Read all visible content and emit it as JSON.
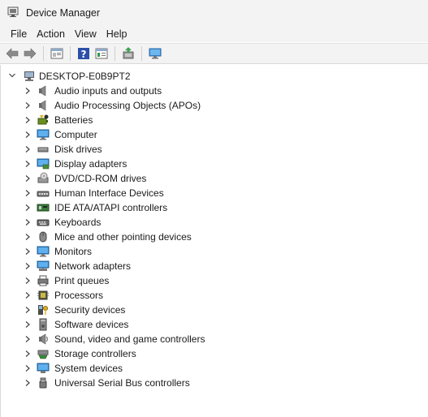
{
  "window": {
    "title": "Device Manager"
  },
  "menu": [
    "File",
    "Action",
    "View",
    "Help"
  ],
  "toolbar": [
    "back-icon",
    "forward-icon",
    "properties-icon",
    "help-icon",
    "show-hide-tree-icon",
    "update-driver-icon",
    "computer-monitor-icon"
  ],
  "tree": {
    "root": "DESKTOP-E0B9PT2",
    "categories": [
      {
        "label": "Audio inputs and outputs",
        "icon": "speaker-icon"
      },
      {
        "label": "Audio Processing Objects (APOs)",
        "icon": "speaker-icon"
      },
      {
        "label": "Batteries",
        "icon": "battery-icon"
      },
      {
        "label": "Computer",
        "icon": "computer-icon"
      },
      {
        "label": "Disk drives",
        "icon": "disk-drive-icon"
      },
      {
        "label": "Display adapters",
        "icon": "display-adapter-icon"
      },
      {
        "label": "DVD/CD-ROM drives",
        "icon": "dvd-drive-icon"
      },
      {
        "label": "Human Interface Devices",
        "icon": "hid-icon"
      },
      {
        "label": "IDE ATA/ATAPI controllers",
        "icon": "ide-controller-icon"
      },
      {
        "label": "Keyboards",
        "icon": "keyboard-icon"
      },
      {
        "label": "Mice and other pointing devices",
        "icon": "mouse-icon"
      },
      {
        "label": "Monitors",
        "icon": "monitor-icon"
      },
      {
        "label": "Network adapters",
        "icon": "network-adapter-icon"
      },
      {
        "label": "Print queues",
        "icon": "printer-icon"
      },
      {
        "label": "Processors",
        "icon": "processor-icon"
      },
      {
        "label": "Security devices",
        "icon": "security-key-icon"
      },
      {
        "label": "Software devices",
        "icon": "software-device-icon"
      },
      {
        "label": "Sound, video and game controllers",
        "icon": "sound-icon"
      },
      {
        "label": "Storage controllers",
        "icon": "storage-controller-icon"
      },
      {
        "label": "System devices",
        "icon": "system-devices-icon"
      },
      {
        "label": "Universal Serial Bus controllers",
        "icon": "usb-icon"
      }
    ]
  }
}
